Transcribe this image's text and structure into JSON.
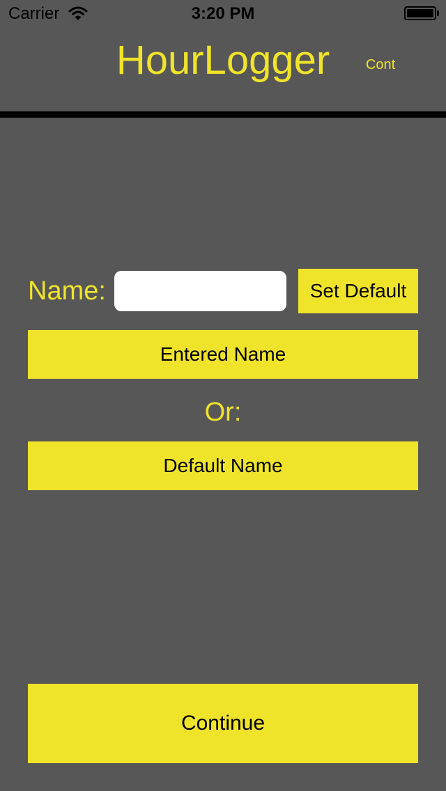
{
  "status_bar": {
    "carrier": "Carrier",
    "time": "3:20 PM",
    "wifi_icon": "wifi-icon",
    "battery_icon": "battery-icon",
    "battery_level": 1.0
  },
  "header": {
    "title": "HourLogger",
    "cont_label": "Cont"
  },
  "form": {
    "name_label": "Name:",
    "name_value": "",
    "name_placeholder": "",
    "set_default_label": "Set Default",
    "entered_name_label": "Entered Name",
    "or_label": "Or:",
    "default_name_label": "Default Name",
    "continue_label": "Continue"
  },
  "colors": {
    "background": "#575757",
    "accent": "#f0e42a",
    "divider": "#000000",
    "button_text": "#000000"
  }
}
